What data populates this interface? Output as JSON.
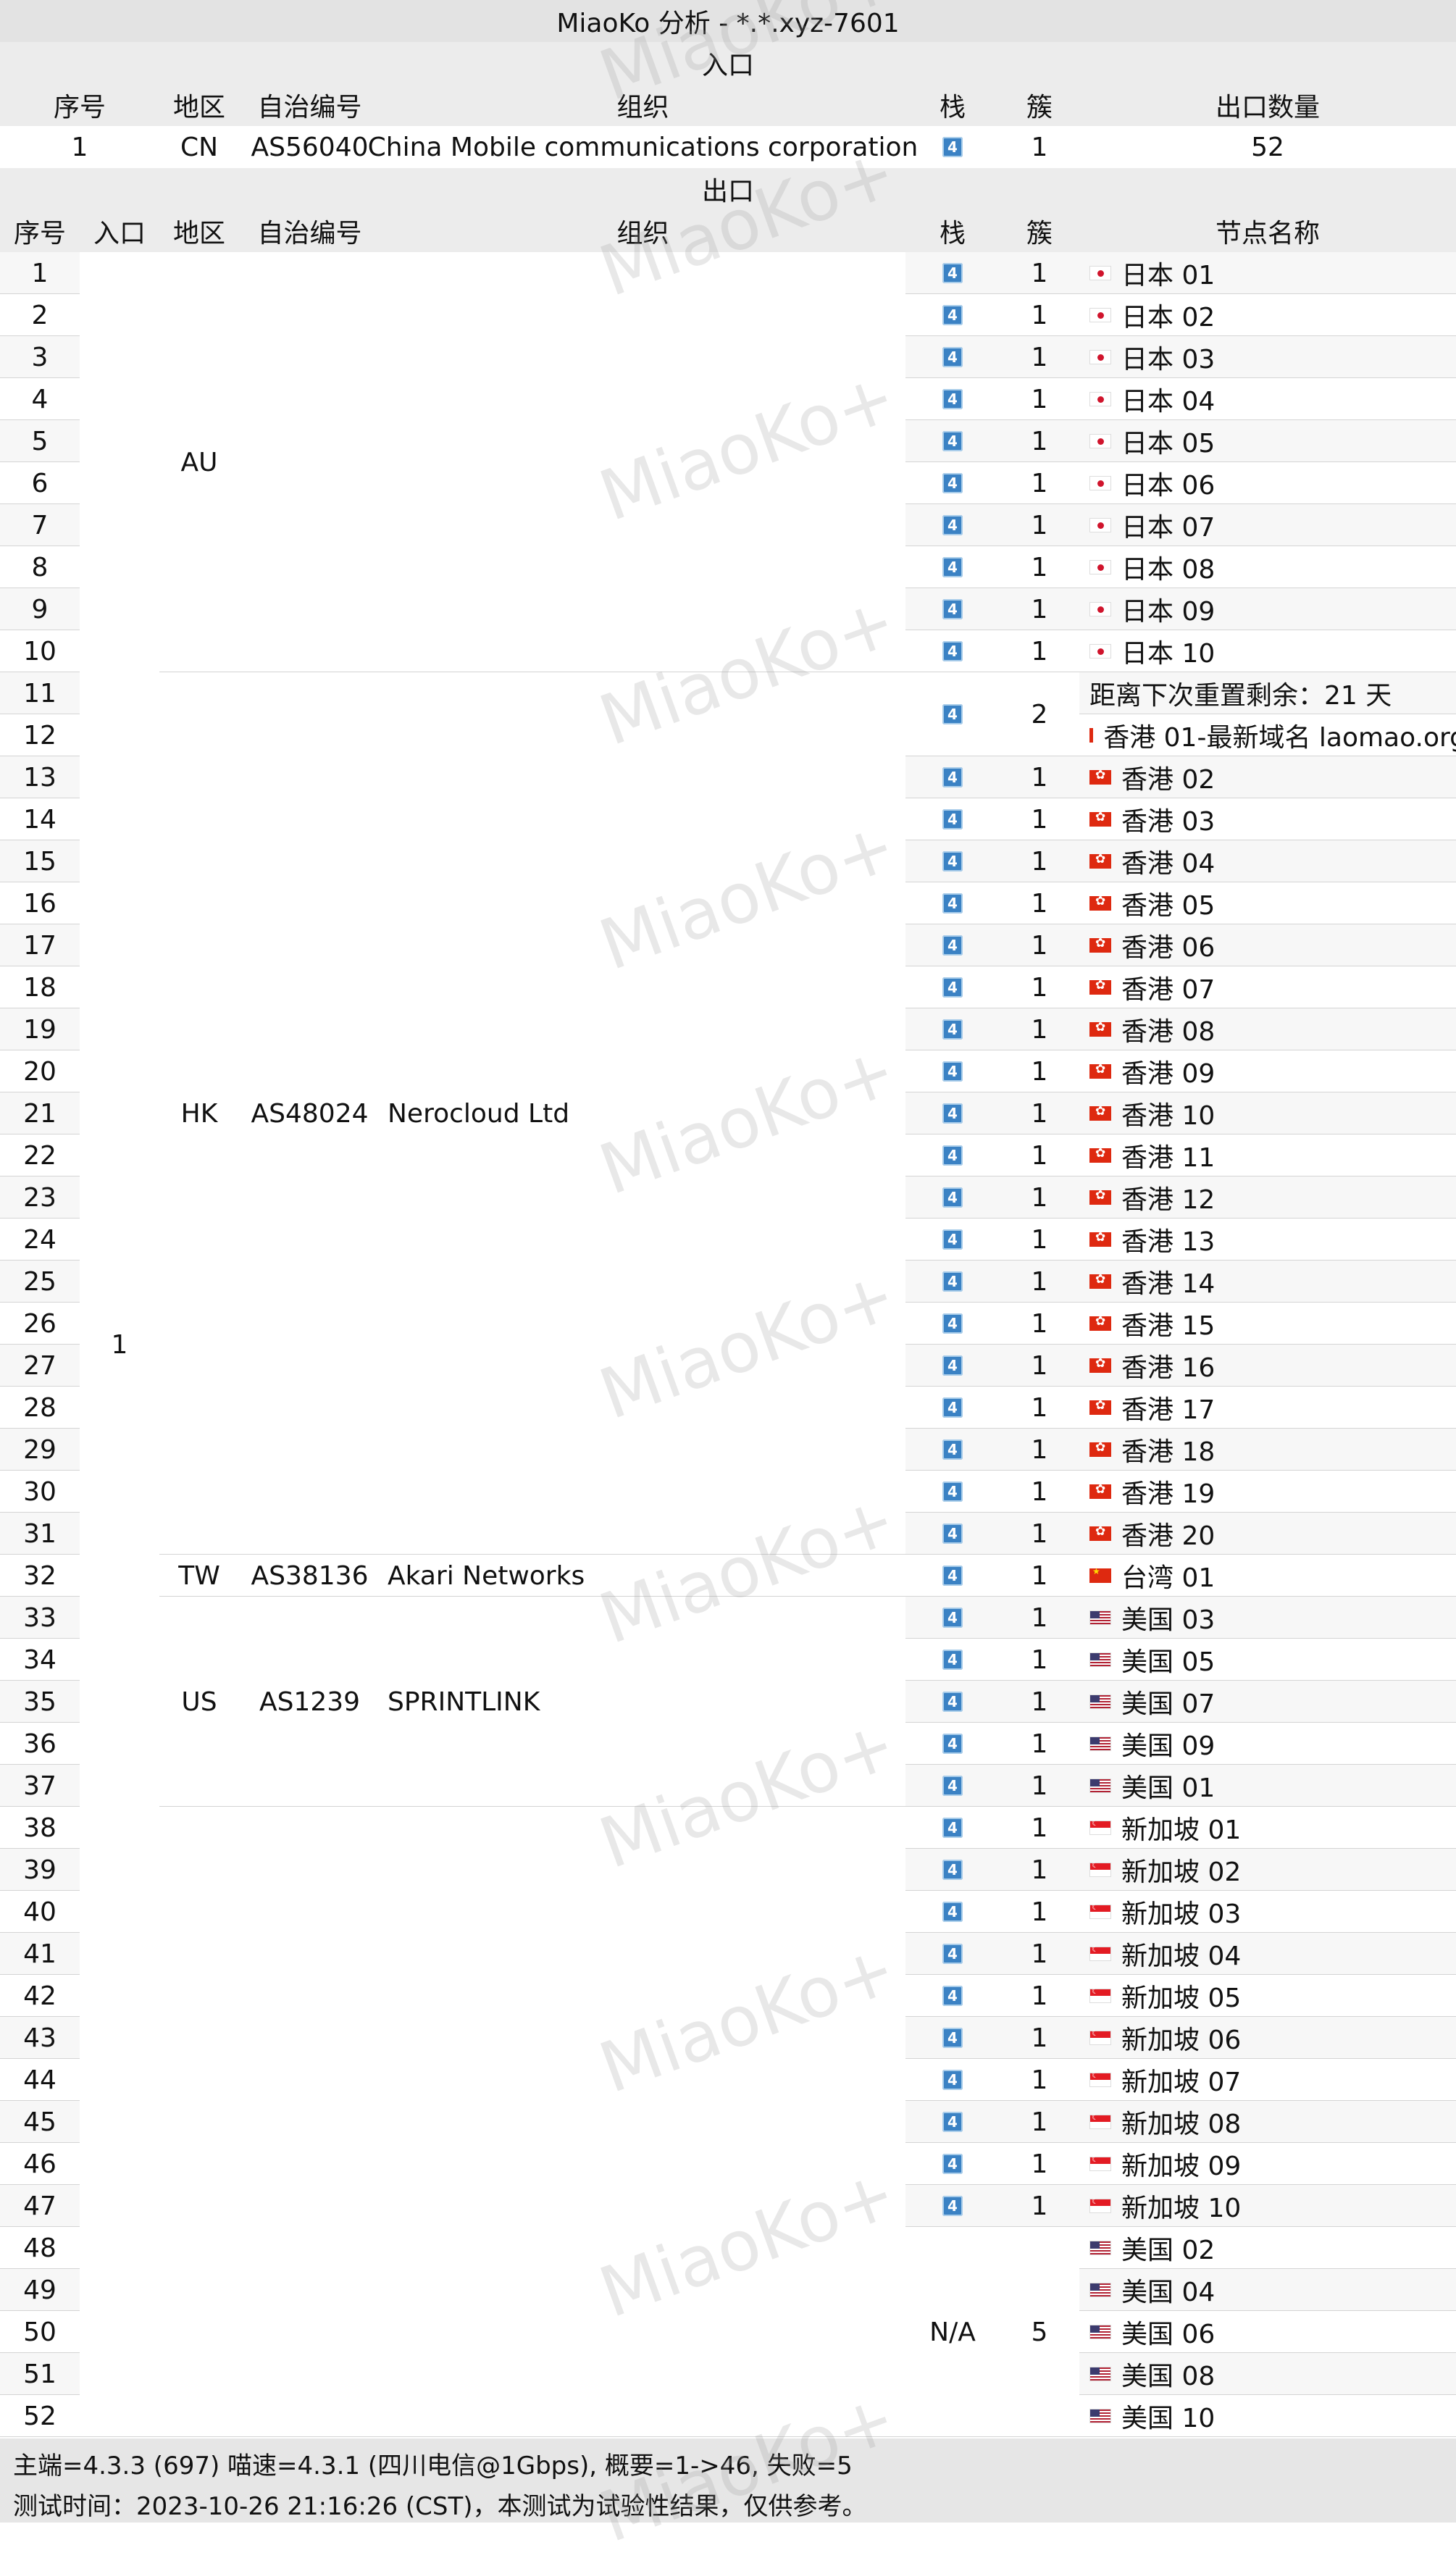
{
  "title": "MiaoKo 分析 - *.*.xyz-7601",
  "watermark": "MiaoKo+",
  "entry_section": {
    "label": "入口",
    "headers": [
      "序号",
      "地区",
      "自治编号",
      "组织",
      "栈",
      "簇",
      "出口数量"
    ],
    "row": {
      "seq": "1",
      "region": "CN",
      "asn": "AS56040",
      "org": "China Mobile communications corporation",
      "stack": "4",
      "cluster": "1",
      "count": "52"
    }
  },
  "exit_section": {
    "label": "出口",
    "headers": [
      "序号",
      "入口",
      "地区",
      "自治编号",
      "组织",
      "栈",
      "簇",
      "节点名称"
    ],
    "entry_value": "1",
    "groups": [
      {
        "region": "AU",
        "asn": "",
        "org": "",
        "start": 1,
        "end": 10
      },
      {
        "region": "HK",
        "asn": "AS48024",
        "org": "Nerocloud Ltd",
        "start": 11,
        "end": 31
      },
      {
        "region": "TW",
        "asn": "AS38136",
        "org": "Akari Networks",
        "start": 32,
        "end": 32
      },
      {
        "region": "US",
        "asn": "AS1239",
        "org": "SPRINTLINK",
        "start": 33,
        "end": 37
      },
      {
        "region": "",
        "asn": "",
        "org": "",
        "start": 38,
        "end": 52
      }
    ],
    "stack_groups": [
      {
        "start": 11,
        "end": 12,
        "stack": "4",
        "cluster": "2"
      },
      {
        "start": 48,
        "end": 52,
        "stack": "N/A",
        "cluster": "5"
      }
    ],
    "nodes": [
      {
        "seq": "1",
        "flag": "jp",
        "name": "日本 01"
      },
      {
        "seq": "2",
        "flag": "jp",
        "name": "日本 02"
      },
      {
        "seq": "3",
        "flag": "jp",
        "name": "日本 03"
      },
      {
        "seq": "4",
        "flag": "jp",
        "name": "日本 04"
      },
      {
        "seq": "5",
        "flag": "jp",
        "name": "日本 05"
      },
      {
        "seq": "6",
        "flag": "jp",
        "name": "日本 06"
      },
      {
        "seq": "7",
        "flag": "jp",
        "name": "日本 07"
      },
      {
        "seq": "8",
        "flag": "jp",
        "name": "日本 08"
      },
      {
        "seq": "9",
        "flag": "jp",
        "name": "日本 09"
      },
      {
        "seq": "10",
        "flag": "jp",
        "name": "日本 10"
      },
      {
        "seq": "11",
        "flag": "",
        "name": "距离下次重置剩余：21 天"
      },
      {
        "seq": "12",
        "flag": "hk",
        "name": "香港 01-最新域名 laomao.org"
      },
      {
        "seq": "13",
        "flag": "hk",
        "name": "香港 02"
      },
      {
        "seq": "14",
        "flag": "hk",
        "name": "香港 03"
      },
      {
        "seq": "15",
        "flag": "hk",
        "name": "香港 04"
      },
      {
        "seq": "16",
        "flag": "hk",
        "name": "香港 05"
      },
      {
        "seq": "17",
        "flag": "hk",
        "name": "香港 06"
      },
      {
        "seq": "18",
        "flag": "hk",
        "name": "香港 07"
      },
      {
        "seq": "19",
        "flag": "hk",
        "name": "香港 08"
      },
      {
        "seq": "20",
        "flag": "hk",
        "name": "香港 09"
      },
      {
        "seq": "21",
        "flag": "hk",
        "name": "香港 10"
      },
      {
        "seq": "22",
        "flag": "hk",
        "name": "香港 11"
      },
      {
        "seq": "23",
        "flag": "hk",
        "name": "香港 12"
      },
      {
        "seq": "24",
        "flag": "hk",
        "name": "香港 13"
      },
      {
        "seq": "25",
        "flag": "hk",
        "name": "香港 14"
      },
      {
        "seq": "26",
        "flag": "hk",
        "name": "香港 15"
      },
      {
        "seq": "27",
        "flag": "hk",
        "name": "香港 16"
      },
      {
        "seq": "28",
        "flag": "hk",
        "name": "香港 17"
      },
      {
        "seq": "29",
        "flag": "hk",
        "name": "香港 18"
      },
      {
        "seq": "30",
        "flag": "hk",
        "name": "香港 19"
      },
      {
        "seq": "31",
        "flag": "hk",
        "name": "香港 20"
      },
      {
        "seq": "32",
        "flag": "tw",
        "name": "台湾 01"
      },
      {
        "seq": "33",
        "flag": "us",
        "name": "美国 03"
      },
      {
        "seq": "34",
        "flag": "us",
        "name": "美国 05"
      },
      {
        "seq": "35",
        "flag": "us",
        "name": "美国 07"
      },
      {
        "seq": "36",
        "flag": "us",
        "name": "美国 09"
      },
      {
        "seq": "37",
        "flag": "us",
        "name": "美国 01"
      },
      {
        "seq": "38",
        "flag": "sg",
        "name": "新加坡 01"
      },
      {
        "seq": "39",
        "flag": "sg",
        "name": "新加坡 02"
      },
      {
        "seq": "40",
        "flag": "sg",
        "name": "新加坡 03"
      },
      {
        "seq": "41",
        "flag": "sg",
        "name": "新加坡 04"
      },
      {
        "seq": "42",
        "flag": "sg",
        "name": "新加坡 05"
      },
      {
        "seq": "43",
        "flag": "sg",
        "name": "新加坡 06"
      },
      {
        "seq": "44",
        "flag": "sg",
        "name": "新加坡 07"
      },
      {
        "seq": "45",
        "flag": "sg",
        "name": "新加坡 08"
      },
      {
        "seq": "46",
        "flag": "sg",
        "name": "新加坡 09"
      },
      {
        "seq": "47",
        "flag": "sg",
        "name": "新加坡 10"
      },
      {
        "seq": "48",
        "flag": "us",
        "name": "美国 02"
      },
      {
        "seq": "49",
        "flag": "us",
        "name": "美国 04"
      },
      {
        "seq": "50",
        "flag": "us",
        "name": "美国 06"
      },
      {
        "seq": "51",
        "flag": "us",
        "name": "美国 08"
      },
      {
        "seq": "52",
        "flag": "us",
        "name": "美国 10"
      }
    ]
  },
  "footer": {
    "line1": "主端=4.3.3 (697) 喵速=4.3.1 (四川电信@1Gbps), 概要=1->46, 失败=5",
    "line2": "测试时间：2023-10-26 21:16:26 (CST)，本测试为试验性结果，仅供参考。"
  },
  "colors": {
    "header_bg": "#ececec",
    "alt_bg": "#f7f7f7",
    "footer_bg": "#e6e6e6",
    "badge": "#3b82c4"
  }
}
